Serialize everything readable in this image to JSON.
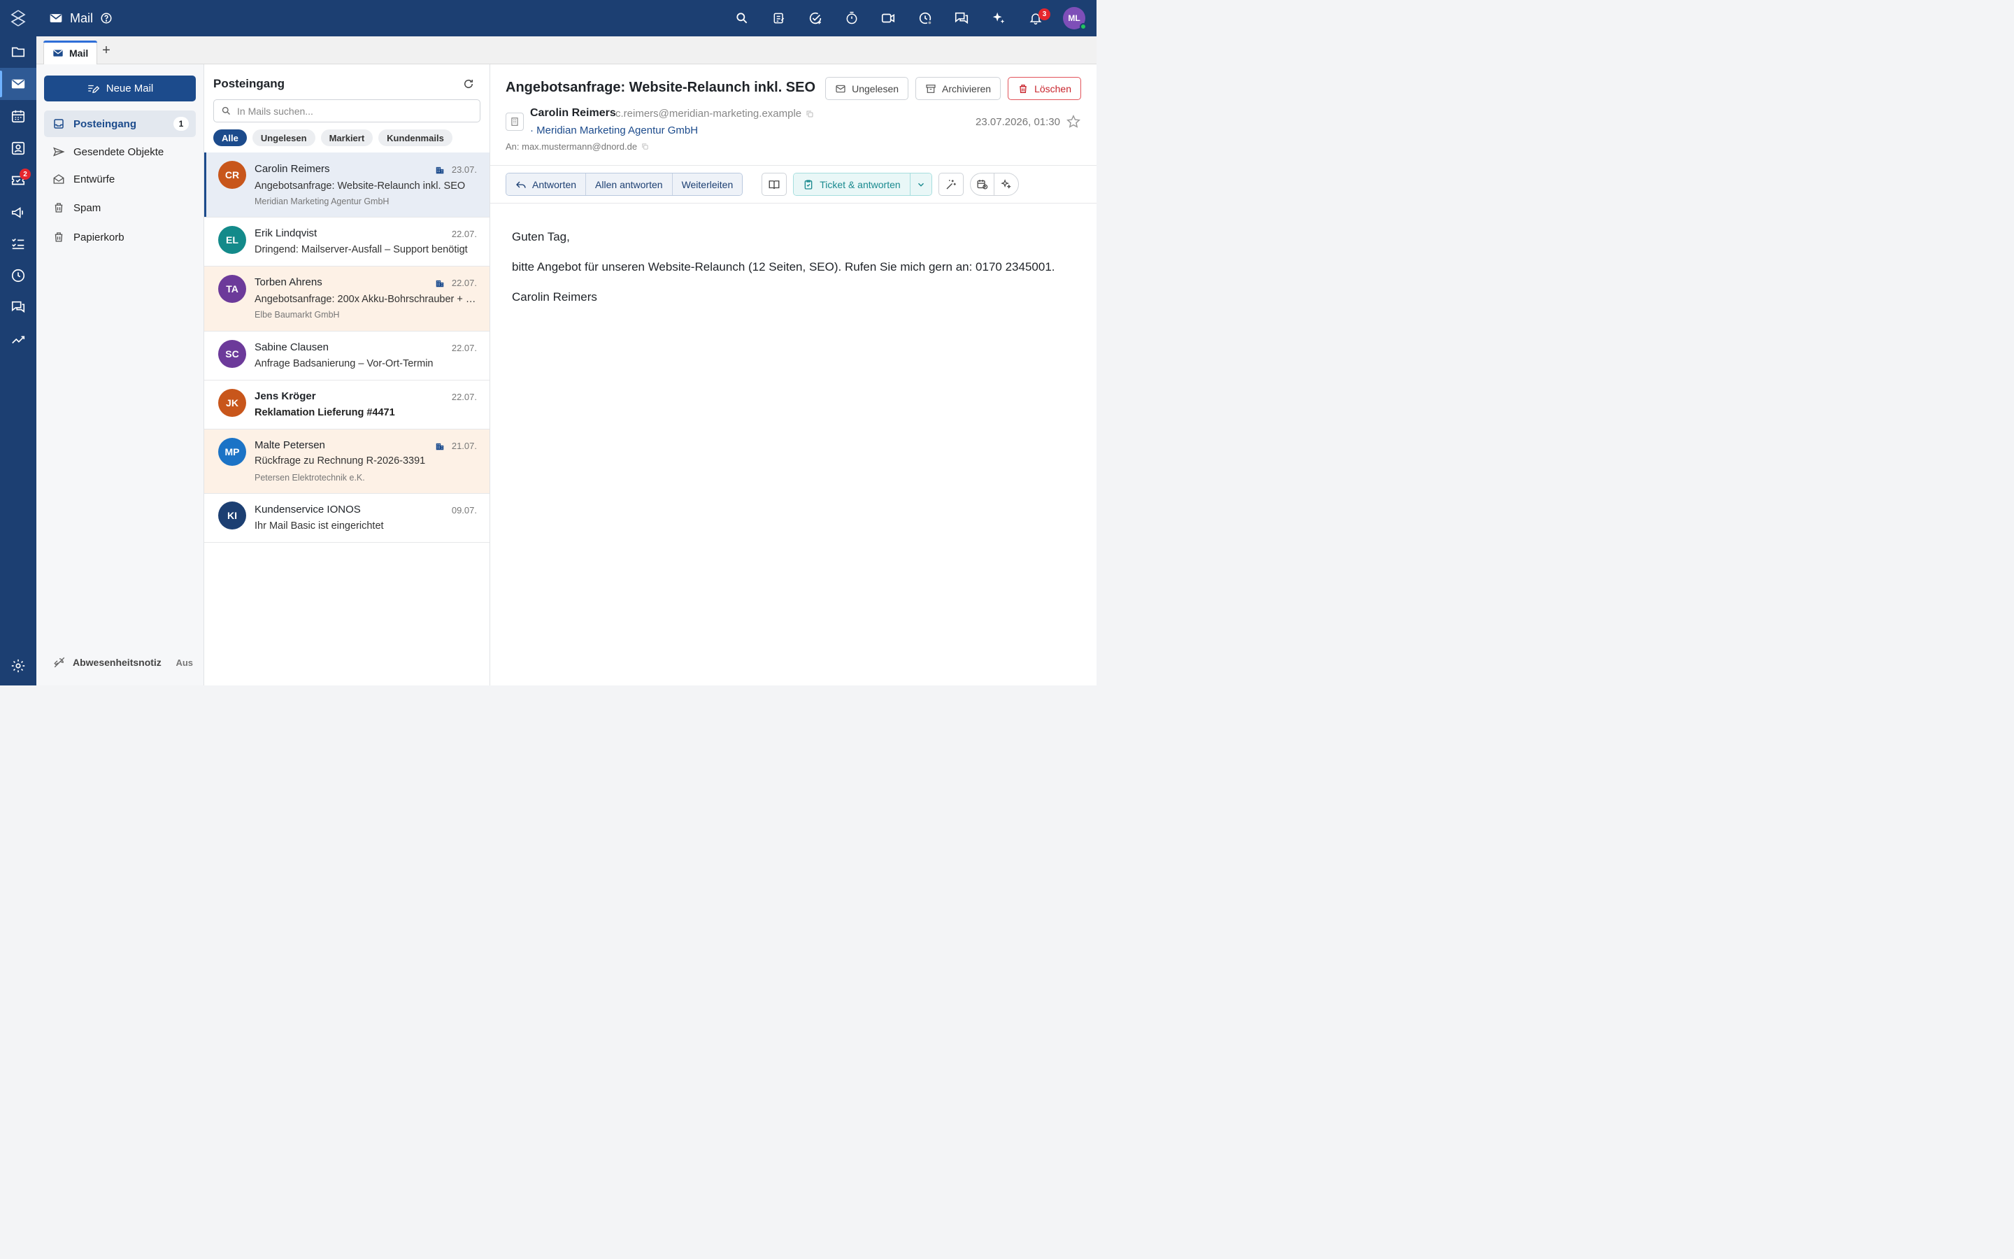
{
  "app": {
    "title": "Mail"
  },
  "topbar": {
    "notification_count": "3",
    "user_initials": "ML"
  },
  "rail": {
    "tickets_badge": "2"
  },
  "tabs": [
    {
      "label": "Mail"
    }
  ],
  "sidebar": {
    "new_mail_label": "Neue Mail",
    "folders": [
      {
        "label": "Posteingang",
        "count": "1"
      },
      {
        "label": "Gesendete Objekte"
      },
      {
        "label": "Entwürfe"
      },
      {
        "label": "Spam"
      },
      {
        "label": "Papierkorb"
      }
    ],
    "absence": {
      "label": "Abwesenheitsnotiz",
      "state": "Aus"
    }
  },
  "list": {
    "title": "Posteingang",
    "search_placeholder": "In Mails suchen...",
    "filters": [
      "Alle",
      "Ungelesen",
      "Markiert",
      "Kundenmails"
    ],
    "mails": [
      {
        "initials": "CR",
        "color": "#c8561b",
        "from": "Carolin Reimers",
        "date": "23.07.",
        "subject": "Angebotsanfrage: Website-Relaunch inkl. SEO",
        "company": "Meridian Marketing Agentur GmbH"
      },
      {
        "initials": "EL",
        "color": "#138a8a",
        "from": "Erik Lindqvist",
        "date": "22.07.",
        "subject": "Dringend: Mailserver-Ausfall – Support benötigt"
      },
      {
        "initials": "TA",
        "color": "#6c3a9a",
        "from": "Torben Ahrens",
        "date": "22.07.",
        "subject": "Angebotsanfrage: 200x Akku-Bohrschrauber + Zubehör",
        "company": "Elbe Baumarkt GmbH"
      },
      {
        "initials": "SC",
        "color": "#6c3a9a",
        "from": "Sabine Clausen",
        "date": "22.07.",
        "subject": "Anfrage Badsanierung – Vor-Ort-Termin"
      },
      {
        "initials": "JK",
        "color": "#c8561b",
        "from": "Jens Kröger",
        "date": "22.07.",
        "subject": "Reklamation Lieferung #4471"
      },
      {
        "initials": "MP",
        "color": "#1b73c6",
        "from": "Malte Petersen",
        "date": "21.07.",
        "subject": "Rückfrage zu Rechnung R-2026-3391",
        "company": "Petersen Elektrotechnik e.K."
      },
      {
        "initials": "KI",
        "color": "#1c3f72",
        "from": "Kundenservice IONOS",
        "date": "09.07.",
        "subject": "Ihr Mail Basic ist eingerichtet"
      }
    ]
  },
  "reader": {
    "subject": "Angebotsanfrage: Website-Relaunch inkl. SEO",
    "actions": {
      "unread": "Ungelesen",
      "archive": "Archivieren",
      "delete": "Löschen"
    },
    "sender_name": "Carolin Reimers",
    "sender_email": "c.reimers@meridian-marketing.example",
    "sender_org": "· Meridian Marketing Agentur GmbH",
    "to": "An: max.mustermann@dnord.de",
    "date": "23.07.2026, 01:30",
    "toolbar": {
      "reply": "Antworten",
      "reply_all": "Allen antworten",
      "forward": "Weiterleiten",
      "ticket": "Ticket & antworten"
    },
    "body": [
      "Guten Tag,",
      "bitte Angebot für unseren Website-Relaunch (12 Seiten, SEO). Rufen Sie mich gern an: 0170 2345001.",
      "Carolin Reimers"
    ]
  }
}
